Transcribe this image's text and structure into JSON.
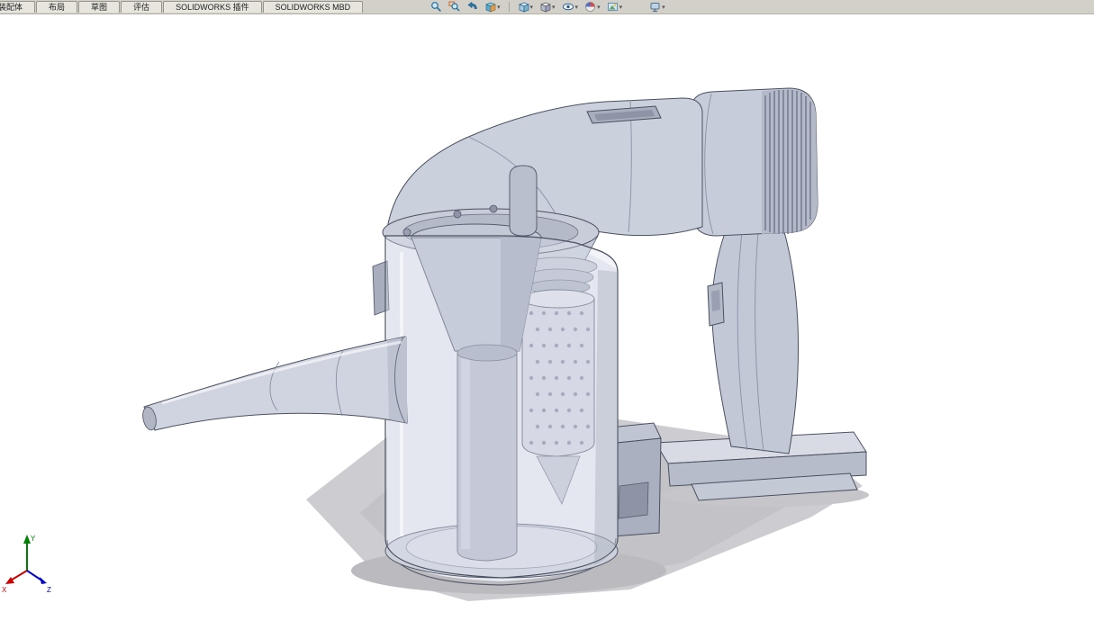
{
  "ribbon": {
    "tabs": [
      {
        "label": "装配体"
      },
      {
        "label": "布局"
      },
      {
        "label": "草图"
      },
      {
        "label": "评估"
      },
      {
        "label": "SOLIDWORKS 插件"
      },
      {
        "label": "SOLIDWORKS MBD"
      }
    ]
  },
  "view_toolbar": {
    "icons": [
      {
        "name": "zoom-to-fit-icon"
      },
      {
        "name": "zoom-to-area-icon"
      },
      {
        "name": "previous-view-icon"
      },
      {
        "name": "section-view-icon"
      },
      {
        "name": "view-orientation-icon",
        "dropdown": true
      },
      {
        "name": "display-style-icon",
        "dropdown": true
      },
      {
        "name": "hide-show-items-icon",
        "dropdown": true
      },
      {
        "name": "edit-appearance-icon",
        "dropdown": true
      },
      {
        "name": "apply-scene-icon",
        "dropdown": true
      },
      {
        "name": "view-settings-icon",
        "dropdown": true
      }
    ]
  },
  "triad": {
    "x_label": "X",
    "y_label": "Y",
    "z_label": "Z",
    "x_color": "#cc0000",
    "y_color": "#008000",
    "z_color": "#0000cc"
  },
  "model": {
    "palette": {
      "body": "#c7ccda",
      "body_light": "#d4d8e2",
      "body_dark": "#aab0c3",
      "interior": "#e7eaf1",
      "outline": "#4a5060",
      "shadow": "#c2c2c7"
    }
  }
}
